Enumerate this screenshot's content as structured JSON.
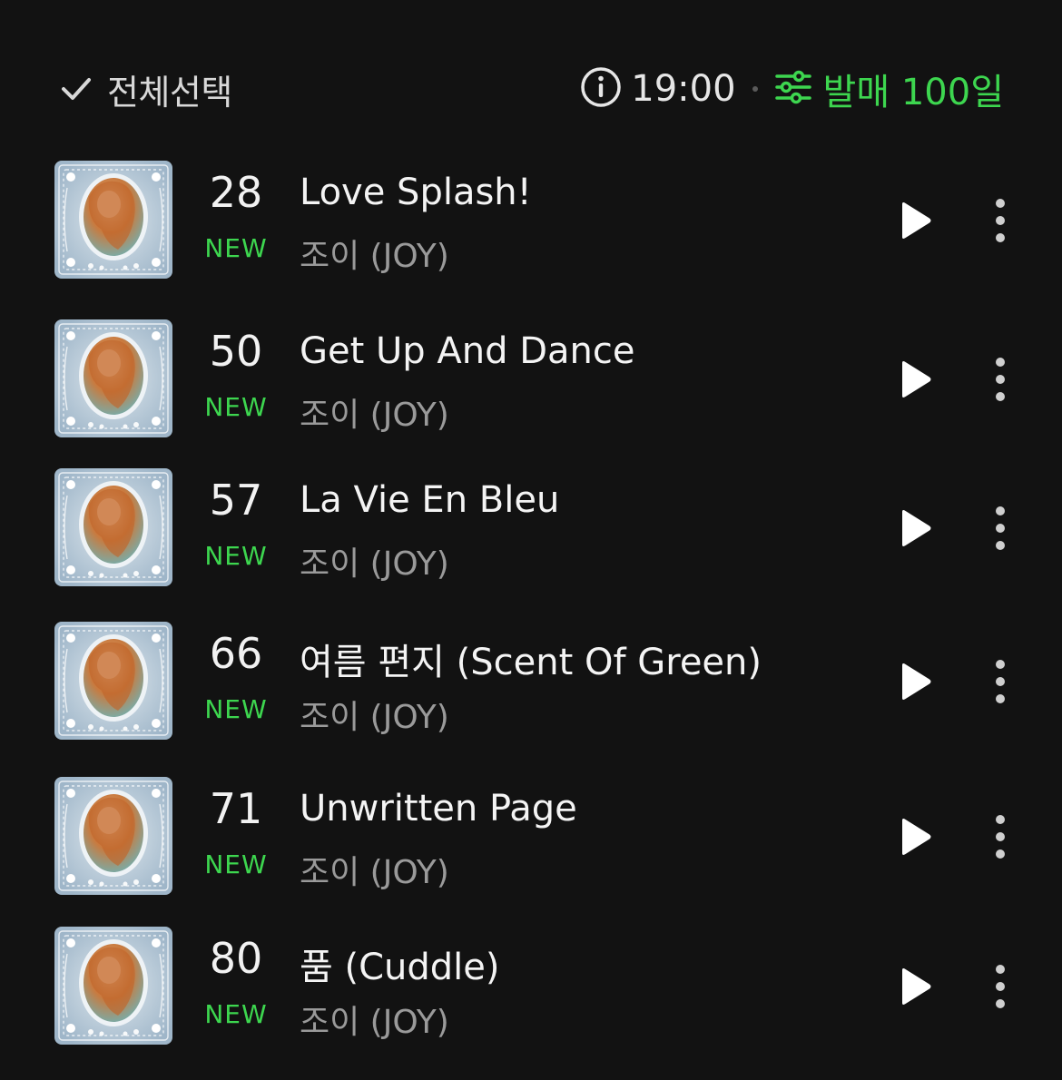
{
  "toolbar": {
    "select_all_label": "전체선택",
    "time": "19:00",
    "filter_label": "발매 100일",
    "accent_color": "#3dd64f"
  },
  "tracks": [
    {
      "rank": "28",
      "badge": "NEW",
      "title": "Love Splash!",
      "artist": "조이 (JOY)"
    },
    {
      "rank": "50",
      "badge": "NEW",
      "title": "Get Up And Dance",
      "artist": "조이 (JOY)"
    },
    {
      "rank": "57",
      "badge": "NEW",
      "title": "La Vie En Bleu",
      "artist": "조이 (JOY)"
    },
    {
      "rank": "66",
      "badge": "NEW",
      "title": "여름 편지 (Scent Of Green)",
      "artist": "조이 (JOY)"
    },
    {
      "rank": "71",
      "badge": "NEW",
      "title": "Unwritten Page",
      "artist": "조이 (JOY)"
    },
    {
      "rank": "80",
      "badge": "NEW",
      "title": "품 (Cuddle)",
      "artist": "조이 (JOY)"
    }
  ],
  "icons": {
    "check": "check-icon",
    "info": "info-icon",
    "filter": "sliders-icon",
    "play": "play-icon",
    "more": "more-vertical-icon",
    "cover": "album-cover"
  }
}
